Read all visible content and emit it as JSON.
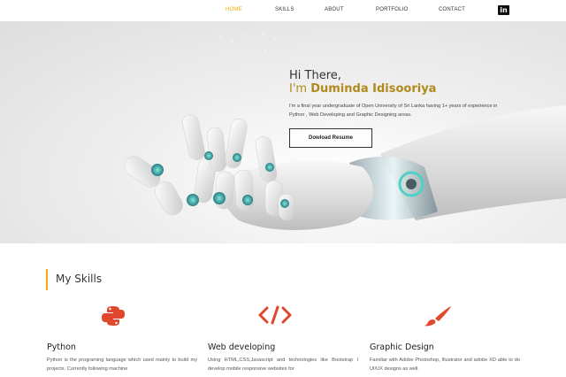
{
  "nav": {
    "items": [
      {
        "label": "HOME",
        "active": true
      },
      {
        "label": "SKILLS",
        "active": false
      },
      {
        "label": "ABOUT",
        "active": false
      },
      {
        "label": "PORTFOLIO",
        "active": false
      },
      {
        "label": "CONTACT",
        "active": false
      }
    ],
    "social_icon": "linkedin-icon",
    "social_label": "in"
  },
  "hero": {
    "greeting": "Hi There,",
    "name_prefix": "I'm ",
    "name": "Duminda Idisooriya",
    "description": "I'm a final year undergraduate of Open University of Sri Lanka having 1+ years of experience in Python , Web Developing and Graphic Designing areas.",
    "button_label": "Dowload Resume"
  },
  "skills": {
    "heading": "My Skills",
    "items": [
      {
        "icon": "python-icon",
        "title": "Python",
        "description": "Python is the programing language which used mainly to build my projects. Currently following machine"
      },
      {
        "icon": "code-icon",
        "title": "Web developing",
        "description": "Using HTML,CSS,Javascript and technologies like Bootstrap I develop mobile responsive websites for"
      },
      {
        "icon": "paintbrush-icon",
        "title": "Graphic Design",
        "description": "Familiar with Adobe Photoshop, Illustrator and adobe XD able to do UI/UX designs as well."
      }
    ]
  },
  "colors": {
    "accent": "#f2a900",
    "name_gold": "#b08a1a",
    "icon_red": "#e0482e"
  }
}
